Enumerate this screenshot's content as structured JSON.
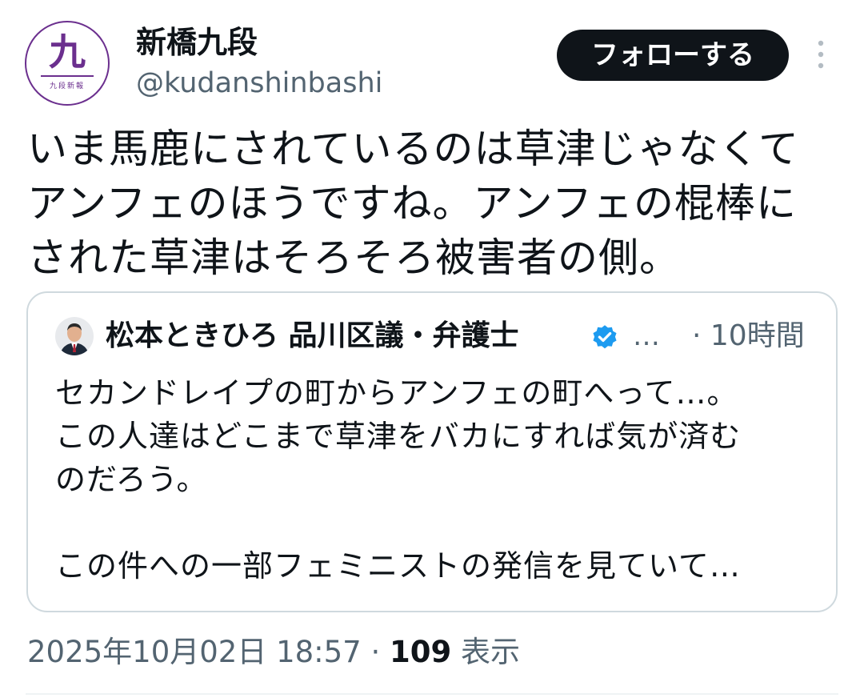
{
  "author": {
    "display_name": "新橋九段",
    "handle": "@kudanshinbashi",
    "avatar_glyph": "九",
    "avatar_subtext": "九段新報"
  },
  "follow_button": {
    "label": "フォローする"
  },
  "icons": {
    "more": "more-vertical-icon",
    "verified": "verified-badge-icon"
  },
  "post": {
    "text": "いま馬鹿にされているのは草津じゃなくてアンフェのほうですね。アンフェの棍棒にされた草津はそろそろ被害者の側。"
  },
  "quoted_post": {
    "author_name": "松本ときひろ 品川区議・弁護士",
    "ellipsis": "…",
    "time": "· 10時間",
    "lines": [
      "セカンドレイプの町からアンフェの町へって…。",
      "この人達はどこまで草津をバカにすれば気が済む",
      "のだろう。",
      "",
      "この件への一部フェミニストの発信を見ていて…"
    ]
  },
  "meta": {
    "timestamp": "2025年10月02日 18:57",
    "separator": " · ",
    "views_count": "109",
    "views_label": "表示"
  },
  "colors": {
    "text_primary": "#0f1419",
    "text_secondary": "#536471",
    "follow_bg": "#0f1419",
    "border": "#cfd9de",
    "verified": "#1d9bf0",
    "avatar_brand": "#6b2f8e"
  }
}
